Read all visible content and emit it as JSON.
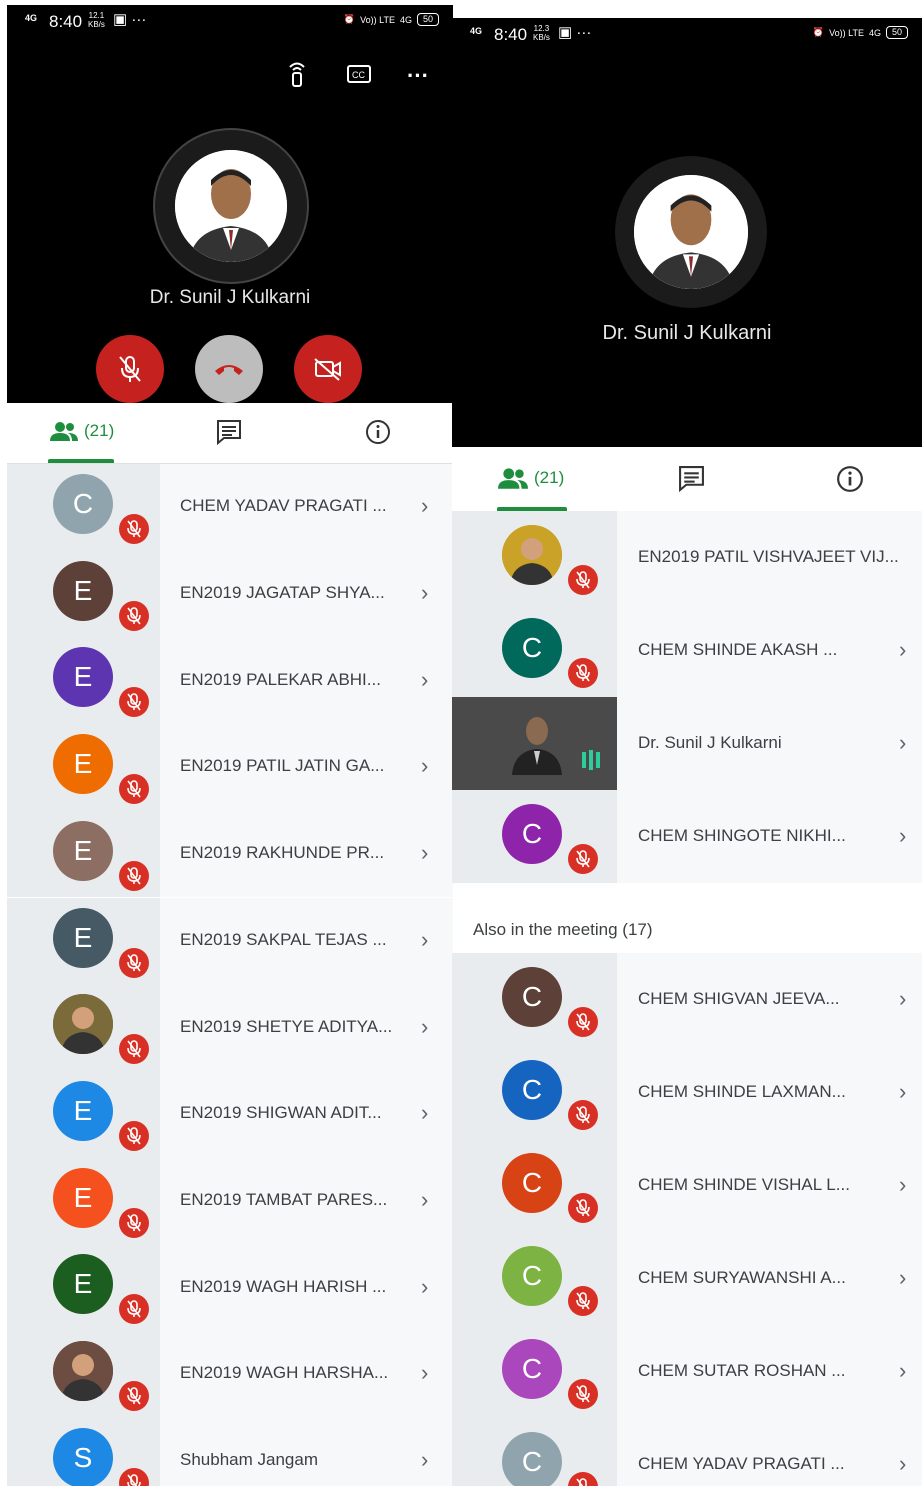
{
  "left": {
    "status": {
      "network": "4G",
      "time": "8:40",
      "speed": "12.1",
      "speed_unit": "KB/s",
      "battery": "50",
      "lte": "Vo)) LTE",
      "net2": "4G"
    },
    "host_name": "Dr. Sunil J Kulkarni",
    "participants_count": "(21)",
    "participants": [
      {
        "initial": "C",
        "name": "CHEM YADAV PRAGATI ...",
        "color": "#90a4ae"
      },
      {
        "initial": "E",
        "name": "EN2019 JAGATAP SHYA...",
        "color": "#5d4037"
      },
      {
        "initial": "E",
        "name": "EN2019 PALEKAR ABHI...",
        "color": "#5e35b1"
      },
      {
        "initial": "E",
        "name": "EN2019 PATIL JATIN GA...",
        "color": "#ef6c00"
      },
      {
        "initial": "E",
        "name": "EN2019 RAKHUNDE PR...",
        "color": "#8d6e63"
      },
      {
        "initial": "E",
        "name": "EN2019 SAKPAL TEJAS ...",
        "color": "#455a64"
      },
      {
        "initial": "",
        "name": "EN2019 SHETYE ADITYA...",
        "color": "#7b6a3a",
        "photo": true
      },
      {
        "initial": "E",
        "name": "EN2019 SHIGWAN ADIT...",
        "color": "#1e88e5"
      },
      {
        "initial": "E",
        "name": "EN2019 TAMBAT PARES...",
        "color": "#f4511e"
      },
      {
        "initial": "E",
        "name": "EN2019 WAGH HARISH ...",
        "color": "#1b5e20"
      },
      {
        "initial": "",
        "name": "EN2019 WAGH HARSHA...",
        "color": "#6d4c41",
        "photo": true
      },
      {
        "initial": "S",
        "name": "Shubham Jangam",
        "color": "#1e88e5"
      }
    ]
  },
  "right": {
    "status": {
      "network": "4G",
      "time": "8:40",
      "speed": "12.3",
      "speed_unit": "KB/s",
      "battery": "50",
      "lte": "Vo)) LTE",
      "net2": "4G"
    },
    "host_name": "Dr. Sunil J Kulkarni",
    "participants_count": "(21)",
    "top_participants": [
      {
        "initial": "",
        "name": "EN2019 PATIL VISHVAJEET VIJ...",
        "color": "#c9a227",
        "photo": true,
        "chevron": false
      },
      {
        "initial": "C",
        "name": "CHEM SHINDE AKASH ...",
        "color": "#00695c",
        "chevron": true
      },
      {
        "initial": "",
        "name": "Dr. Sunil J Kulkarni",
        "color": "#555",
        "presenter": true,
        "chevron": true
      },
      {
        "initial": "C",
        "name": "CHEM SHINGOTE NIKHI...",
        "color": "#8e24aa",
        "chevron": true
      }
    ],
    "also_label": "Also in the meeting (17)",
    "others": [
      {
        "initial": "C",
        "name": "CHEM SHIGVAN JEEVA...",
        "color": "#5d4037"
      },
      {
        "initial": "C",
        "name": "CHEM SHINDE LAXMAN...",
        "color": "#1565c0"
      },
      {
        "initial": "C",
        "name": "CHEM SHINDE VISHAL L...",
        "color": "#d84315"
      },
      {
        "initial": "C",
        "name": "CHEM SURYAWANSHI A...",
        "color": "#7cb342"
      },
      {
        "initial": "C",
        "name": "CHEM SUTAR ROSHAN ...",
        "color": "#ab47bc"
      },
      {
        "initial": "C",
        "name": "CHEM YADAV PRAGATI ...",
        "color": "#90a4ae"
      }
    ]
  },
  "icons": {
    "people": "people-icon",
    "chat": "chat-icon",
    "info": "info-icon",
    "mic_off": "mic-off-icon",
    "chevron": "chevron-right-icon"
  },
  "colors": {
    "accent": "#1e8e3e",
    "danger": "#d93025",
    "end_call": "#bdbdbd"
  }
}
